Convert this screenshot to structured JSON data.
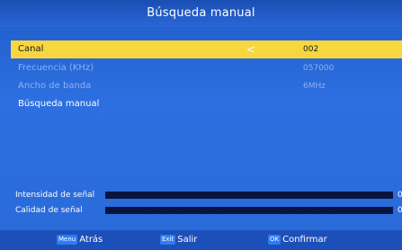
{
  "title": "Búsqueda manual",
  "menu": {
    "canal": {
      "label": "Canal",
      "value": "002"
    },
    "frecuencia": {
      "label": "Frecuencia (KHz)",
      "value": "057000"
    },
    "ancho": {
      "label": "Ancho de banda",
      "value": "6MHz"
    },
    "busqueda": {
      "label": "Búsqueda manual"
    }
  },
  "meters": {
    "intensidad": {
      "label": "Intensidad de señal",
      "value": "0%",
      "level": 0
    },
    "calidad": {
      "label": "Calidad de señal",
      "value": "0%",
      "level": 0
    }
  },
  "footer": {
    "menu_key": "Menu",
    "menu_label": "Atrás",
    "exit_key": "Exit",
    "exit_label": "Salir",
    "ok_key": "OK",
    "ok_label": "Confirmar"
  },
  "colors": {
    "highlight": "#f7d640",
    "background": "#2a6ad9"
  }
}
